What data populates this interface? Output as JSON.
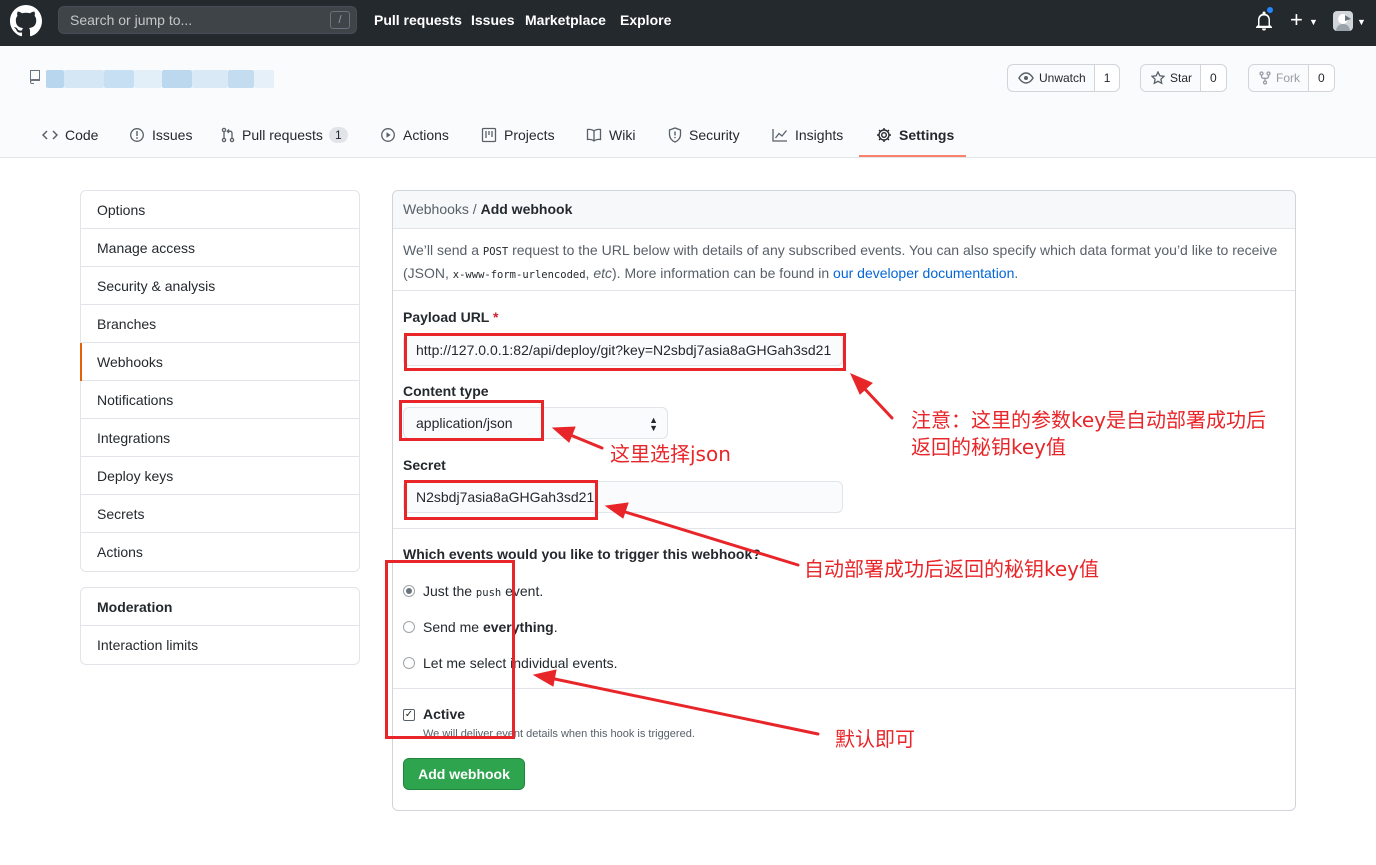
{
  "header": {
    "search_placeholder": "Search or jump to...",
    "search_shortcut": "/",
    "nav": [
      "Pull requests",
      "Issues",
      "Marketplace",
      "Explore"
    ]
  },
  "repo": {
    "buttons": {
      "watch_label": "Unwatch",
      "watch_count": "1",
      "star_label": "Star",
      "star_count": "0",
      "fork_label": "Fork",
      "fork_count": "0"
    },
    "tabs": {
      "code": "Code",
      "issues": "Issues",
      "pulls": "Pull requests",
      "pulls_count": "1",
      "actions": "Actions",
      "projects": "Projects",
      "wiki": "Wiki",
      "security": "Security",
      "insights": "Insights",
      "settings": "Settings"
    }
  },
  "sidebar": {
    "items": [
      "Options",
      "Manage access",
      "Security & analysis",
      "Branches",
      "Webhooks",
      "Notifications",
      "Integrations",
      "Deploy keys",
      "Secrets",
      "Actions"
    ],
    "selected": "Webhooks",
    "moderation_heading": "Moderation",
    "moderation_items": [
      "Interaction limits"
    ]
  },
  "form": {
    "breadcrumb_parent": "Webhooks",
    "breadcrumb_sep": " / ",
    "breadcrumb_current": "Add webhook",
    "intro_1": "We’ll send a ",
    "intro_post": "POST",
    "intro_2": " request to the URL below with details of any subscribed events. You can also specify which data format you’d like to receive (JSON, ",
    "intro_code": "x-www-form-urlencoded",
    "intro_3": ", ",
    "intro_etc": "etc",
    "intro_4": "). More information can be found in ",
    "intro_link": "our developer documentation",
    "intro_5": ".",
    "payload_label": "Payload URL",
    "required_mark": "*",
    "payload_value": "http://127.0.0.1:82/api/deploy/git?key=N2sbdj7asia8aGHGah3sd21",
    "content_type_label": "Content type",
    "content_type_value": "application/json",
    "secret_label": "Secret",
    "secret_value": "N2sbdj7asia8aGHGah3sd21",
    "events_question": "Which events would you like to trigger this webhook?",
    "radio_push_1": "Just the ",
    "radio_push_code": "push",
    "radio_push_2": " event.",
    "radio_all_1": "Send me ",
    "radio_all_2": "everything",
    "radio_all_3": ".",
    "radio_select": "Let me select individual events.",
    "active_label": "Active",
    "active_note": "We will deliver event details when this hook is triggered.",
    "submit_label": "Add webhook"
  },
  "annotations": {
    "note_payload_1": "注意：这里的参数key是自动部署成功后",
    "note_payload_2": "返回的秘钥key值",
    "note_content_type": "这里选择json",
    "note_secret": "自动部署成功后返回的秘钥key值",
    "note_default": "默认即可"
  },
  "colors": {
    "header_bg": "#24292e",
    "accent_tab": "#f9826c",
    "primary_button": "#2ea44f",
    "link": "#0366d6",
    "annotation_red": "#e8262a"
  }
}
